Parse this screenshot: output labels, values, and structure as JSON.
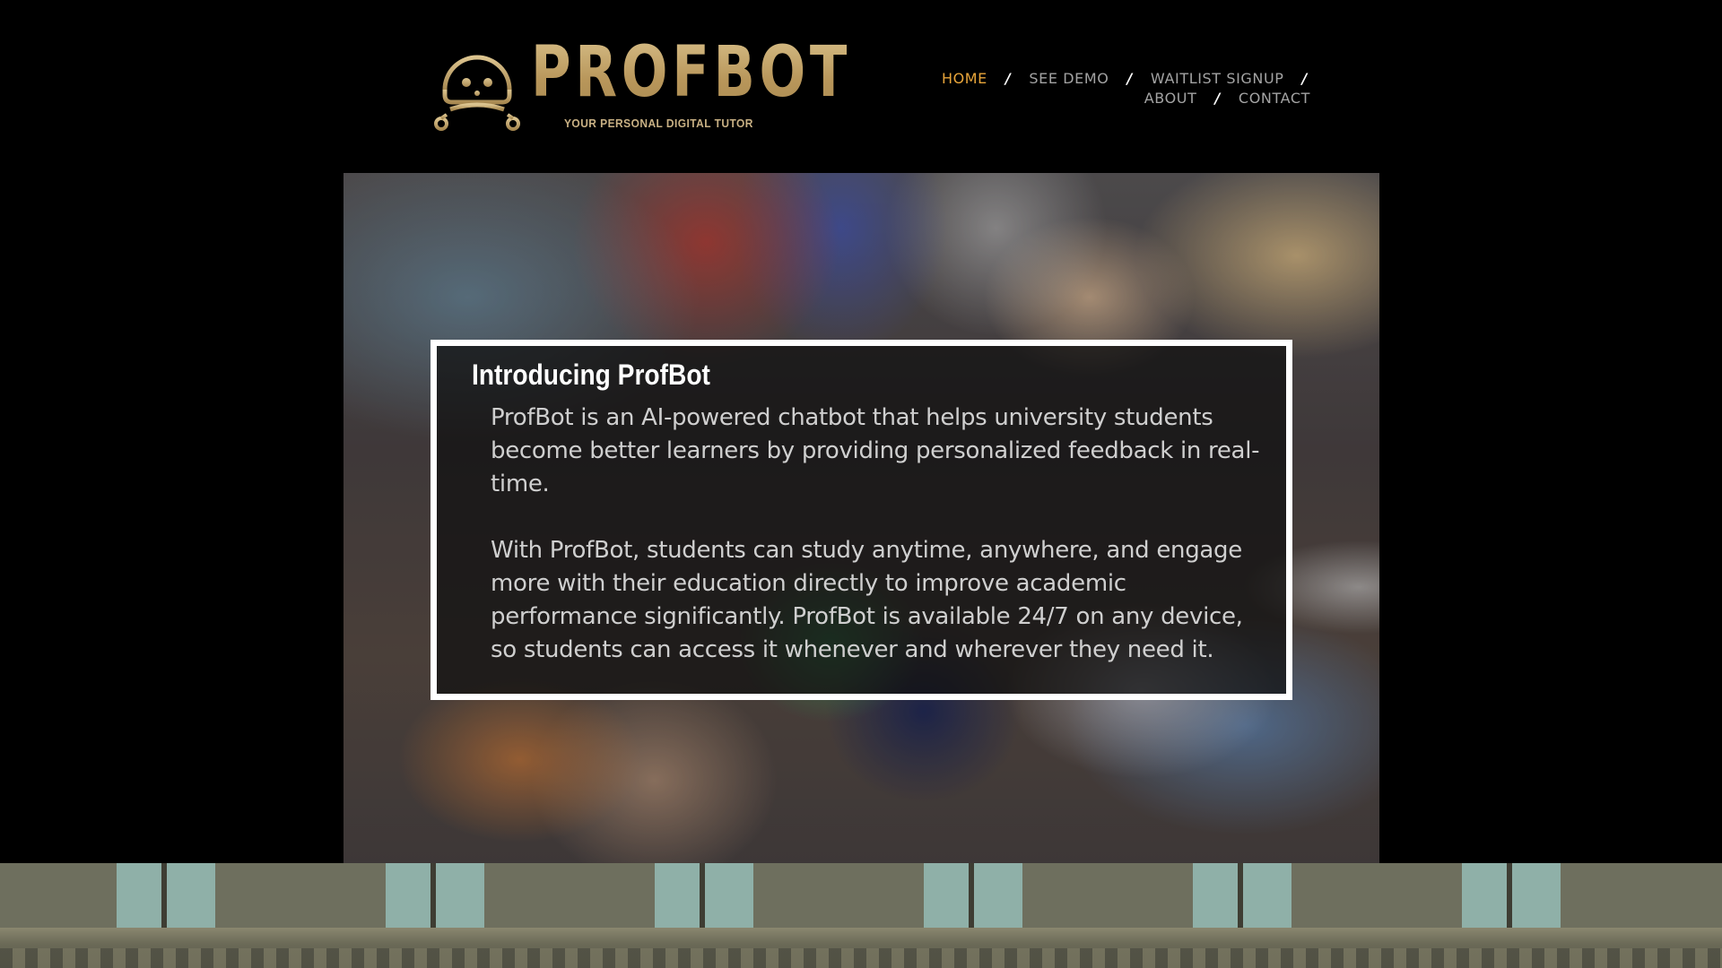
{
  "brand": {
    "name": "PROFBOT",
    "tagline": "YOUR PERSONAL DIGITAL TUTOR",
    "logo_icon": "robot-icon",
    "gold": "#c6a96e"
  },
  "nav": {
    "items": [
      {
        "label": "HOME",
        "active": true
      },
      {
        "label": "SEE DEMO"
      },
      {
        "label": "WAITLIST SIGNUP"
      },
      {
        "label": "ABOUT"
      },
      {
        "label": "CONTACT"
      }
    ],
    "separator": "/",
    "active_color": "#e8a53a"
  },
  "hero": {
    "image": "students-using-phones-photo",
    "title": "Introducing ProfBot",
    "paragraphs": [
      "ProfBot is an AI-powered chatbot that helps university students become better learners by providing personalized feedback in real-time.",
      "With ProfBot, students can study anytime, anywhere, and engage more with their education directly to improve academic performance significantly. ProfBot is available 24/7 on any device, so students can access it whenever and wherever they need it."
    ]
  }
}
